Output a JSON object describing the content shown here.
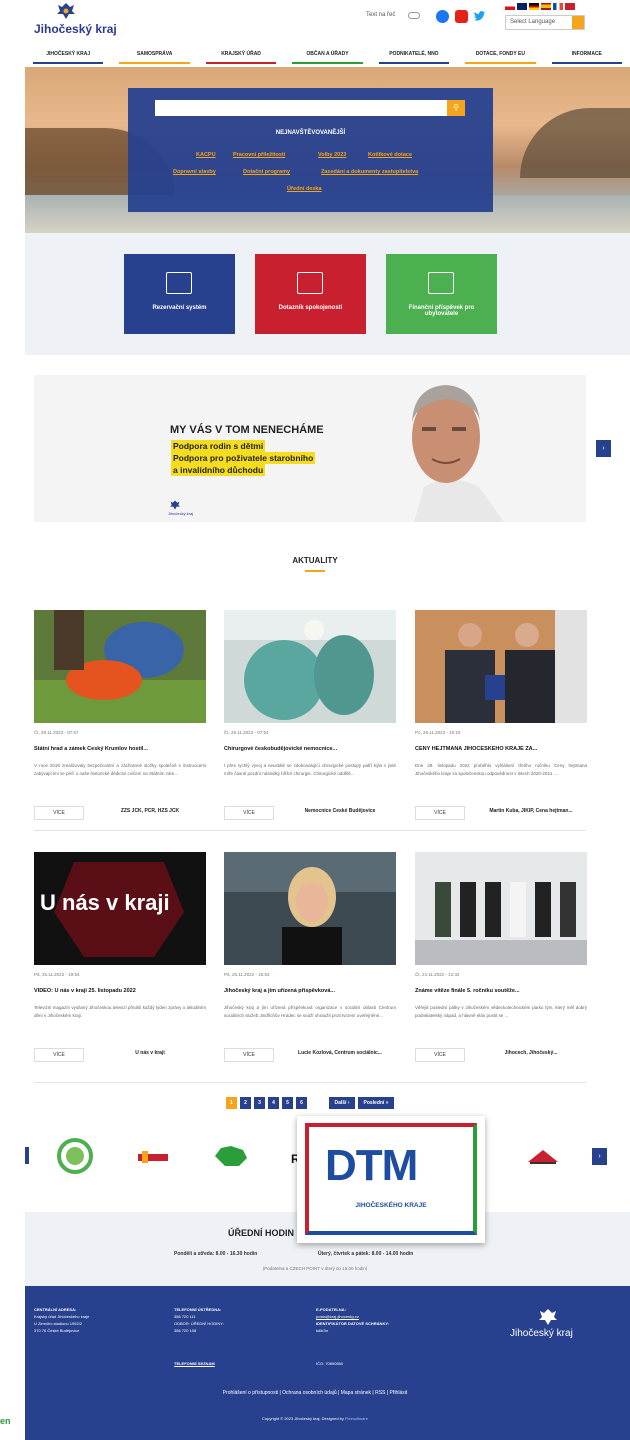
{
  "header": {
    "logo_text": "Jihočeský kraj",
    "text_toggle": "Text na řeč",
    "language_select": "Select Language",
    "colors": {
      "primary": "#27418f",
      "accent": "#f4a51c"
    }
  },
  "nav": [
    {
      "label": "JIHOČESKÝ KRAJ",
      "color": "#27418f"
    },
    {
      "label": "SAMOSPRÁVA",
      "color": "#f4a51c"
    },
    {
      "label": "KRAJSKÝ ÚŘAD",
      "color": "#c8202f"
    },
    {
      "label": "OBČAN A ÚŘADY",
      "color": "#2b9e3c"
    },
    {
      "label": "PODNIKATELÉ, NNO",
      "color": "#27418f"
    },
    {
      "label": "DOTACE, FONDY EU",
      "color": "#f4a51c"
    },
    {
      "label": "INFORMACE",
      "color": "#27418f"
    }
  ],
  "search": {
    "placeholder": "",
    "most_visited_title": "NEJNAVŠTĚVOVANĚJŠÍ",
    "links": [
      "KACPU",
      "Pracovní příležitosti",
      "Volby 2023",
      "Kotlíkové dotace",
      "Dopravní stavby",
      "Dotační programy",
      "Zasedání a dokumenty zastupitelstva",
      "Úřední deska"
    ]
  },
  "tiles": [
    {
      "label": "Rezervační systém",
      "color": "#27418f"
    },
    {
      "label": "Dotazník spokojenosti",
      "color": "#c8202f"
    },
    {
      "label": "Finanční příspěvek pro ubytovatele",
      "color": "#4caf50"
    }
  ],
  "banner": {
    "headline": "MY VÁS V TOM NENECHÁME",
    "lines": [
      "Podpora rodin s dětmi",
      "Podpora pro poživatele starobního",
      "a invalidního důchodu"
    ],
    "logo_text": "Jihočeský kraj"
  },
  "news": {
    "heading": "AKTUALITY",
    "more_label": "VÍCE",
    "items": [
      {
        "date": "Čt, 29.11.2023 - 07:57",
        "title": "Státní hrad a zámek Český Krumlov hostil...",
        "excerpt": "V roce 2019 zrealizovaly bezpečnostní a záchranné složky společně s instruocemi zabývajícími se péčí o naše historické dědictví cvičení na Státním zám...",
        "tag": "ZZS JČK, PČR, HZS JČK"
      },
      {
        "date": "Čt, 29.11.2023 - 07:54",
        "title": "Chirurgové českobudějovické nemocnice...",
        "excerpt": "I přes rychlý vývoj a neustálé se zdokonalující chirurgické postupy patří kýla v jisté míře časné pozdní následky břišní chirurgie. Chirurgické oddělě...",
        "tag": "Nemocnice České Budějovice"
      },
      {
        "date": "Po, 28.11.2023 - 10:15",
        "title": "CENY HEJTMANA JIHOČESKÉHO KRAJE ZA...",
        "excerpt": "Dne 28. listopadu 2022 proběhlo vyhlášení třetího ročníku Ceny hejtmana Jihočeského kraje za společenskou odpovědnost v letech 2020-2021. ...",
        "tag": "Martin Kuba, JIKIP, Cena hejtman..."
      },
      {
        "date": "Pá, 25.11.2022 - 19:54",
        "title": "VIDEO: U nás v kraji 25. listopadu 2022",
        "excerpt": "Televizní magazín vysílaný Jihočeskou televizí přináší každý týden zprávy o aktuálním dění v Jihočeském kraji.",
        "tag": "U nás v kraji",
        "image_text": "U nás v kraji"
      },
      {
        "date": "Pá, 25.11.2022 - 15:53",
        "title": "Jihočeský kraj a jím uřízená příspěvková...",
        "excerpt": "Jihočeský kraj a jím uřízená příspěvková organizace v sociální oblasti Centrum sociálních služeb Jindřichův Hradec se snaží ohraužit proti tvrzení uveřejněné...",
        "tag": "Lucie Kozlová, Centrum sociálníc..."
      },
      {
        "date": "Čt, 24.11.2022 - 12:32",
        "title": "Známe vítěze finále 5. ročníku soutěže...",
        "excerpt": "Věřejili poslední pátky v Jihočeském vědeckotechnickém parku tým, který měl dobrý podnikatelský nápad, a hlavně elán pustit se ...",
        "tag": "Jihocech, Jihočeský..."
      }
    ]
  },
  "pagination": {
    "pages": [
      "1",
      "2",
      "3",
      "4",
      "5",
      "6"
    ],
    "next": "Další ›",
    "last": "Poslední »"
  },
  "partners": {
    "dtm_main": "DTM",
    "dtm_sub": "JIHOČESKÉHO KRAJE",
    "partial_label": "RI"
  },
  "office_hours": {
    "title": "ÚŘEDNÍ HODIN",
    "mon_wed": "Pondělí a středa: 8.00 - 16.30 hodin",
    "tue_thu_fri": "Úterý, čtvrtek a pátek: 8.00 - 14.00 hodin",
    "note": "(Podatelna a CZECH POINT v úterý do 15.00 hodin)"
  },
  "footer": {
    "address_title": "CENTRÁLNÍ ADRESA:",
    "address_lines": [
      "Krajský úřad Jihočeského kraje",
      "U Zimního stadionu 1952/2",
      "370 76 České Budějovice"
    ],
    "phone_title": "TELEFONNÍ ÚSTŘEDNA:",
    "phone": "386 720 111",
    "info_title": "ODBOR: ÚŘEDNÍ HODINY:",
    "info_phone": "386 720 108",
    "phone_list": "TELEFONNÍ SEZNAM",
    "epodatelna_title": "E-PODATELNA:",
    "epodatelna": "posta@kraj-jihocesky.cz",
    "ds_title": "IDENTIFIKÁTOR DATOVÉ SCHRÁNKY:",
    "ds": "kdib3rr",
    "ico": "IČO: 70890650",
    "logo_text": "Jihočeský kraj",
    "links": "Prohlášení o přístupnosti  |  Ochrana osobních údajů  |  Mapa stránek  |  RSS  |  Přihlásit",
    "copyright": "Copyright © 2023 Jihočeský kraj. Designed by",
    "designer": "Fleesoftware",
    "edge_text": "en"
  }
}
